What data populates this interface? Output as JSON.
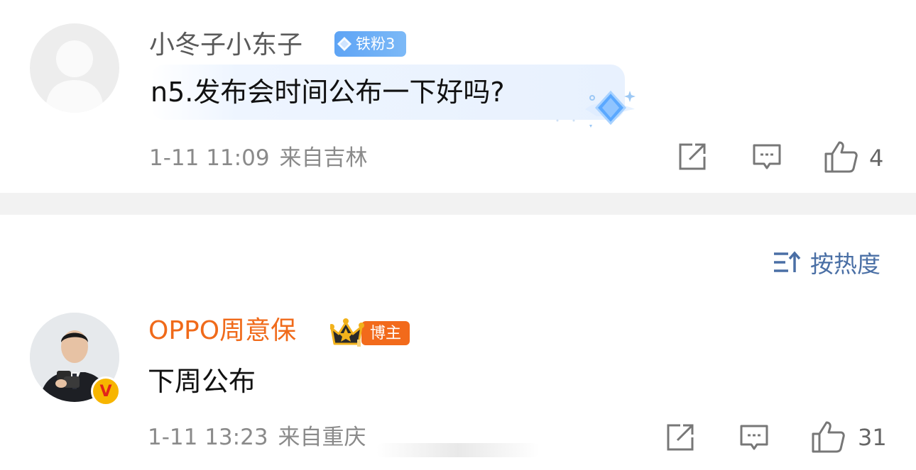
{
  "comments": [
    {
      "username": "小冬子小东子",
      "badge": "铁粉3",
      "text": "n5.发布会时间公布一下好吗?",
      "time": "1-11 11:09",
      "location": "来自吉林",
      "likes": "4",
      "avatar": "default-avatar-icon",
      "username_color": "#5a5a5a"
    },
    {
      "username": "OPPO周意保",
      "badge": "博主",
      "text": "下周公布",
      "time": "1-11 13:23",
      "location": "来自重庆",
      "likes": "31",
      "avatar": "user-photo",
      "verified": "V",
      "username_color": "#f06a1a"
    }
  ],
  "sort": {
    "label": "按热度",
    "icon": "sort-icon"
  },
  "icons": {
    "share": "share-icon",
    "reply": "comment-icon",
    "like": "thumbs-up-icon"
  },
  "colors": {
    "accent_blue": "#4a6fa5",
    "fan_badge": "#5ea4f5",
    "blogger_badge": "#f26a1b",
    "meta_gray": "#8a8a8a",
    "divider": "#f2f2f2"
  }
}
